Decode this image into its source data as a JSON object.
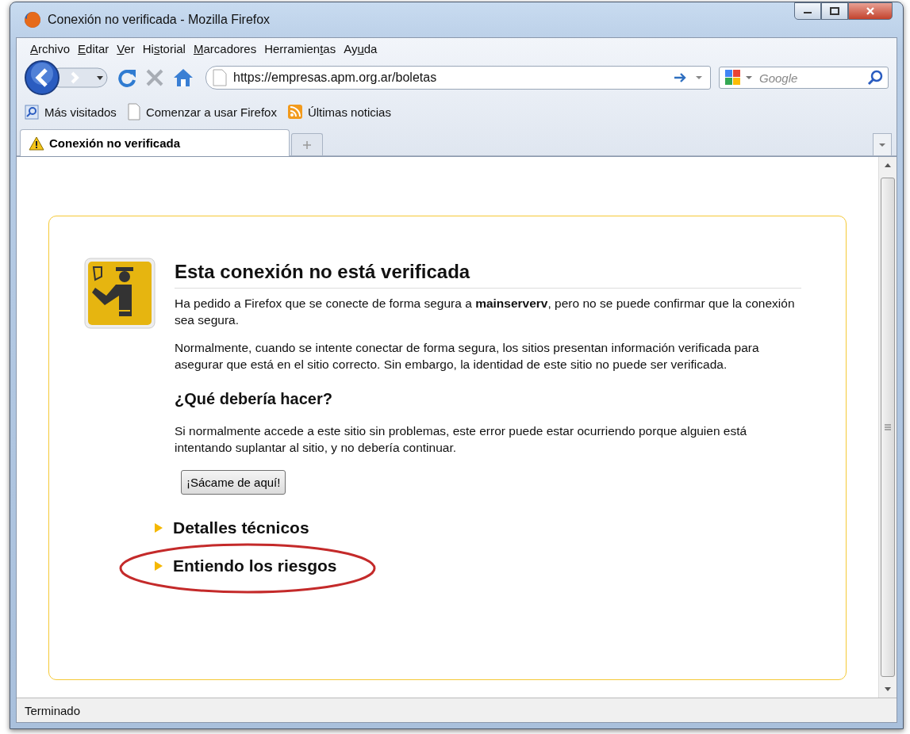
{
  "window": {
    "title": "Conexión no verificada - Mozilla Firefox"
  },
  "menu": [
    {
      "key": "A",
      "after": "rchivo"
    },
    {
      "key": "E",
      "after": "ditar"
    },
    {
      "key": "V",
      "after": "er"
    },
    {
      "before": "Hi",
      "key": "s",
      "after": "torial"
    },
    {
      "key": "M",
      "after": "arcadores"
    },
    {
      "before": "Herramien",
      "key": "t",
      "after": "as"
    },
    {
      "before": "Ay",
      "key": "u",
      "after": "da"
    }
  ],
  "address": {
    "value": "https://empresas.apm.org.ar/boletas"
  },
  "search": {
    "placeholder": "Google"
  },
  "bookmarks": [
    {
      "kind": "search",
      "label": "Más visitados"
    },
    {
      "kind": "page",
      "label": "Comenzar a usar Firefox"
    },
    {
      "kind": "feed",
      "label": "Últimas noticias"
    }
  ],
  "tabs": [
    {
      "label": "Conexión no verificada",
      "selected": true
    }
  ],
  "page": {
    "title": "Esta conexión no está verificada",
    "paragraphs": [
      "Ha pedido a Firefox que se conecte de forma segura a **mainserverv**, pero no se puede confirmar que la conexión sea segura.",
      "Normalmente, cuando se intente conectar de forma segura, los sitios presentan información verificada para asegurar que está en el sitio correcto. Sin embargo, la identidad de este sitio no puede ser verificada."
    ],
    "subtitle": "¿Qué debería hacer?",
    "advice": "Si normalmente accede a este sitio sin problemas, este error puede estar ocurriendo porque alguien está intentando suplantar al sitio, y no debería continuar.",
    "button": "¡Sácame de aquí!",
    "sections": [
      {
        "label": "Detalles técnicos",
        "expanded": false,
        "highlighted": false
      },
      {
        "label": "Entiendo los riesgos",
        "expanded": false,
        "highlighted": true
      }
    ]
  },
  "status_bar": {
    "text": "Terminado"
  }
}
